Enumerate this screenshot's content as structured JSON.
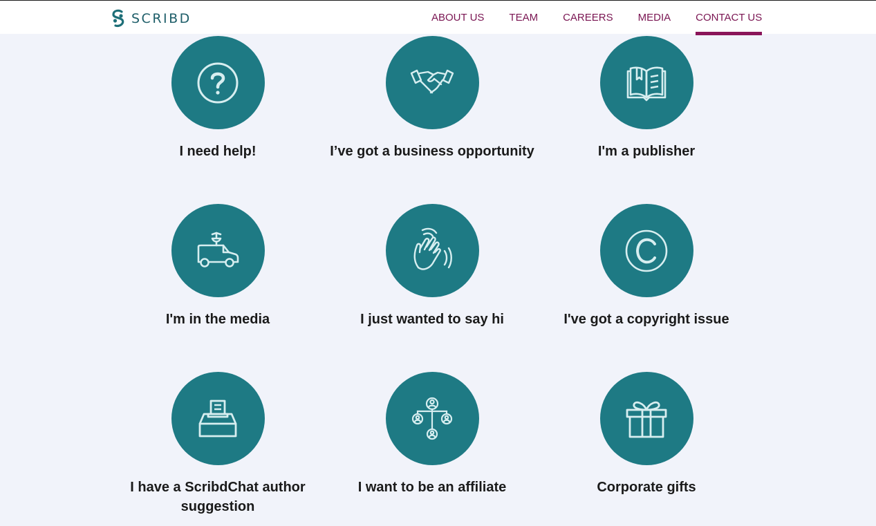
{
  "brand": {
    "name": "SCRIBD",
    "icon": "scribd-logo-icon"
  },
  "nav": {
    "items": [
      {
        "label": "ABOUT US",
        "active": false
      },
      {
        "label": "TEAM",
        "active": false
      },
      {
        "label": "CAREERS",
        "active": false
      },
      {
        "label": "MEDIA",
        "active": false
      },
      {
        "label": "CONTACT US",
        "active": true
      }
    ]
  },
  "contact_options": [
    {
      "label": "I need help!",
      "icon": "question-icon"
    },
    {
      "label": "I’ve got a business opportunity",
      "icon": "handshake-icon"
    },
    {
      "label": "I'm a publisher",
      "icon": "open-book-icon"
    },
    {
      "label": "I'm in the media",
      "icon": "news-van-icon"
    },
    {
      "label": "I just wanted to say hi",
      "icon": "waving-hand-icon"
    },
    {
      "label": "I've got a copyright issue",
      "icon": "copyright-icon"
    },
    {
      "label": "I have a ScribdChat author suggestion",
      "icon": "suggestion-box-icon"
    },
    {
      "label": "I want to be an affiliate",
      "icon": "affiliate-network-icon"
    },
    {
      "label": "Corporate gifts",
      "icon": "gift-icon"
    }
  ],
  "colors": {
    "accent": "#1e7a84",
    "nav_text": "#7a1552",
    "nav_active_underline": "#8a1559",
    "page_background": "#f1f3fa",
    "icon_stroke": "#d7eef0"
  }
}
